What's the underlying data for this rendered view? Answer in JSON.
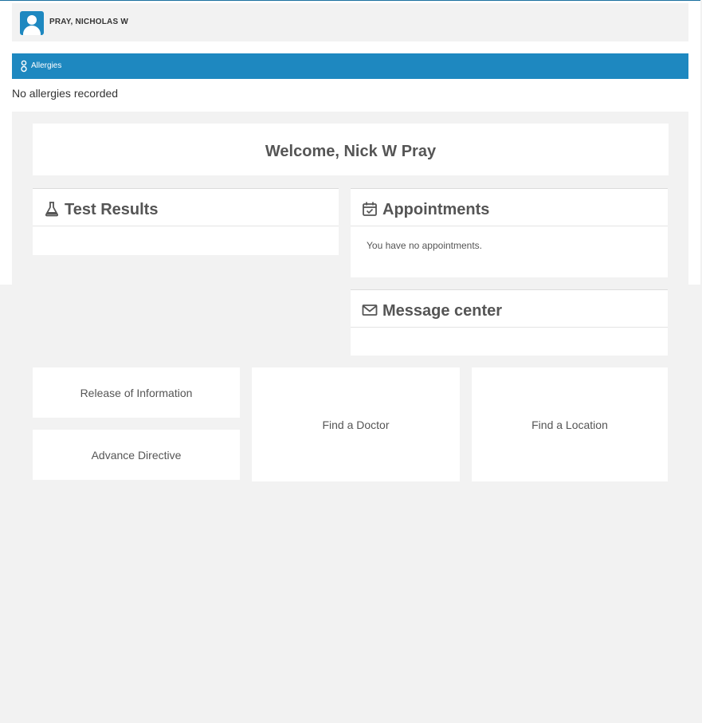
{
  "patient": {
    "name": "PRAY, NICHOLAS W",
    "avatar_icon": "user-icon"
  },
  "allergies": {
    "header": "Allergies",
    "icon": "allergy-icon",
    "empty_text": "No allergies recorded"
  },
  "welcome": {
    "text": "Welcome, Nick W Pray"
  },
  "test_results": {
    "title": "Test Results",
    "icon": "flask-icon"
  },
  "appointments": {
    "title": "Appointments",
    "icon": "calendar-check-icon",
    "empty_text": "You have no appointments."
  },
  "messages": {
    "title": "Message center",
    "icon": "envelope-icon"
  },
  "tiles": {
    "release": "Release of Information",
    "advance": "Advance Directive",
    "doctor": "Find a Doctor",
    "location": "Find a Location"
  },
  "colors": {
    "accent": "#1e88c0",
    "background": "#f2f2f2",
    "text": "#555555"
  }
}
